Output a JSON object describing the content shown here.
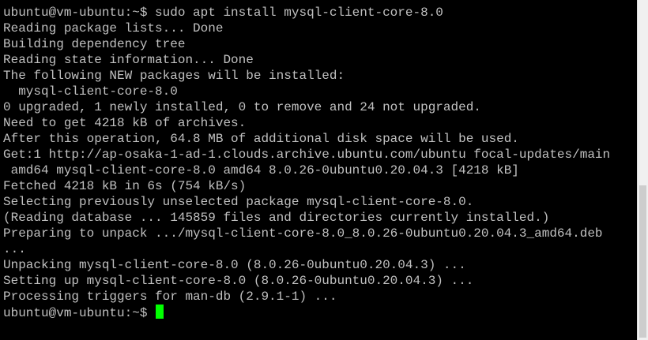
{
  "terminal": {
    "lines": [
      "ubuntu@vm-ubuntu:~$ sudo apt install mysql-client-core-8.0",
      "Reading package lists... Done",
      "Building dependency tree",
      "Reading state information... Done",
      "The following NEW packages will be installed:",
      "  mysql-client-core-8.0",
      "0 upgraded, 1 newly installed, 0 to remove and 24 not upgraded.",
      "Need to get 4218 kB of archives.",
      "After this operation, 64.8 MB of additional disk space will be used.",
      "Get:1 http://ap-osaka-1-ad-1.clouds.archive.ubuntu.com/ubuntu focal-updates/main",
      " amd64 mysql-client-core-8.0 amd64 8.0.26-0ubuntu0.20.04.3 [4218 kB]",
      "Fetched 4218 kB in 6s (754 kB/s)",
      "Selecting previously unselected package mysql-client-core-8.0.",
      "(Reading database ... 145859 files and directories currently installed.)",
      "Preparing to unpack .../mysql-client-core-8.0_8.0.26-0ubuntu0.20.04.3_amd64.deb",
      "...",
      "Unpacking mysql-client-core-8.0 (8.0.26-0ubuntu0.20.04.3) ...",
      "Setting up mysql-client-core-8.0 (8.0.26-0ubuntu0.20.04.3) ...",
      "Processing triggers for man-db (2.9.1-1) ..."
    ],
    "prompt": "ubuntu@vm-ubuntu:~$ ",
    "colors": {
      "background": "#000000",
      "text": "#c0c0c0",
      "cursor": "#00ff00",
      "scrollbar_track": "#f0f0f0",
      "scrollbar_thumb": "#cdcdcd"
    }
  }
}
